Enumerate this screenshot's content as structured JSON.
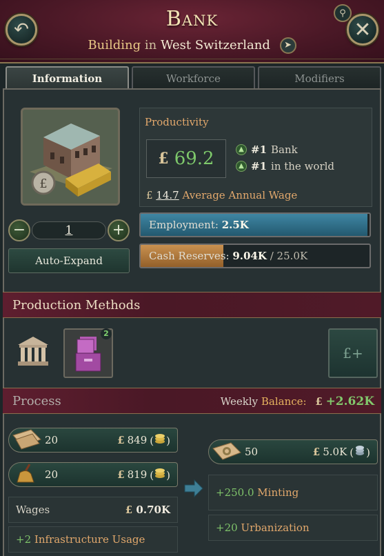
{
  "header": {
    "title": "Bank",
    "subtitle_type": "Building",
    "subtitle_in": "in",
    "subtitle_location": "West Switzerland"
  },
  "tabs": [
    {
      "label": "Information",
      "active": true
    },
    {
      "label": "Workforce",
      "active": false
    },
    {
      "label": "Modifiers",
      "active": false
    }
  ],
  "info": {
    "level": "1",
    "auto_expand_label": "Auto-Expand",
    "productivity_label": "Productivity",
    "currency_symbol": "£",
    "productivity_value": "69.2",
    "rank_local_num": "#1",
    "rank_local_text": "Bank",
    "rank_world_num": "#1",
    "rank_world_text": "in the world",
    "wage_value": "14.7",
    "wage_label": "Average Annual Wage",
    "employment_label": "Employment:",
    "employment_value": "2.5K",
    "employment_fill": 0.99,
    "cash_label": "Cash Reserves:",
    "cash_value": "9.04K",
    "cash_max": "/ 25.0K",
    "cash_fill": 0.3616
  },
  "production_methods": {
    "title": "Production Methods",
    "selected_badge": "2"
  },
  "process": {
    "title": "Process",
    "weekly_label": "Weekly",
    "weekly_balance_label": "Balance:",
    "weekly_value": "+2.62K",
    "inputs": [
      {
        "icon": "paper-icon",
        "qty": "20",
        "price": "849"
      },
      {
        "icon": "hand-bell-icon",
        "qty": "20",
        "price": "819"
      }
    ],
    "wages_label": "Wages",
    "wages_value": "0.70K",
    "infra_value": "+2",
    "infra_label": "Infrastructure Usage",
    "output": {
      "icon": "services-icon",
      "qty": "50",
      "price": "5.0K"
    },
    "minting_value": "+250.0",
    "minting_label": "Minting",
    "urban_value": "+20",
    "urban_label": "Urbanization"
  },
  "colors": {
    "header_bg": "#4a1826",
    "panel_bg": "#273133",
    "positive": "#7fc36a",
    "accent_orange": "#e2a86c",
    "employment_bar": "#2e6b85",
    "cash_bar": "#b07a3c"
  }
}
